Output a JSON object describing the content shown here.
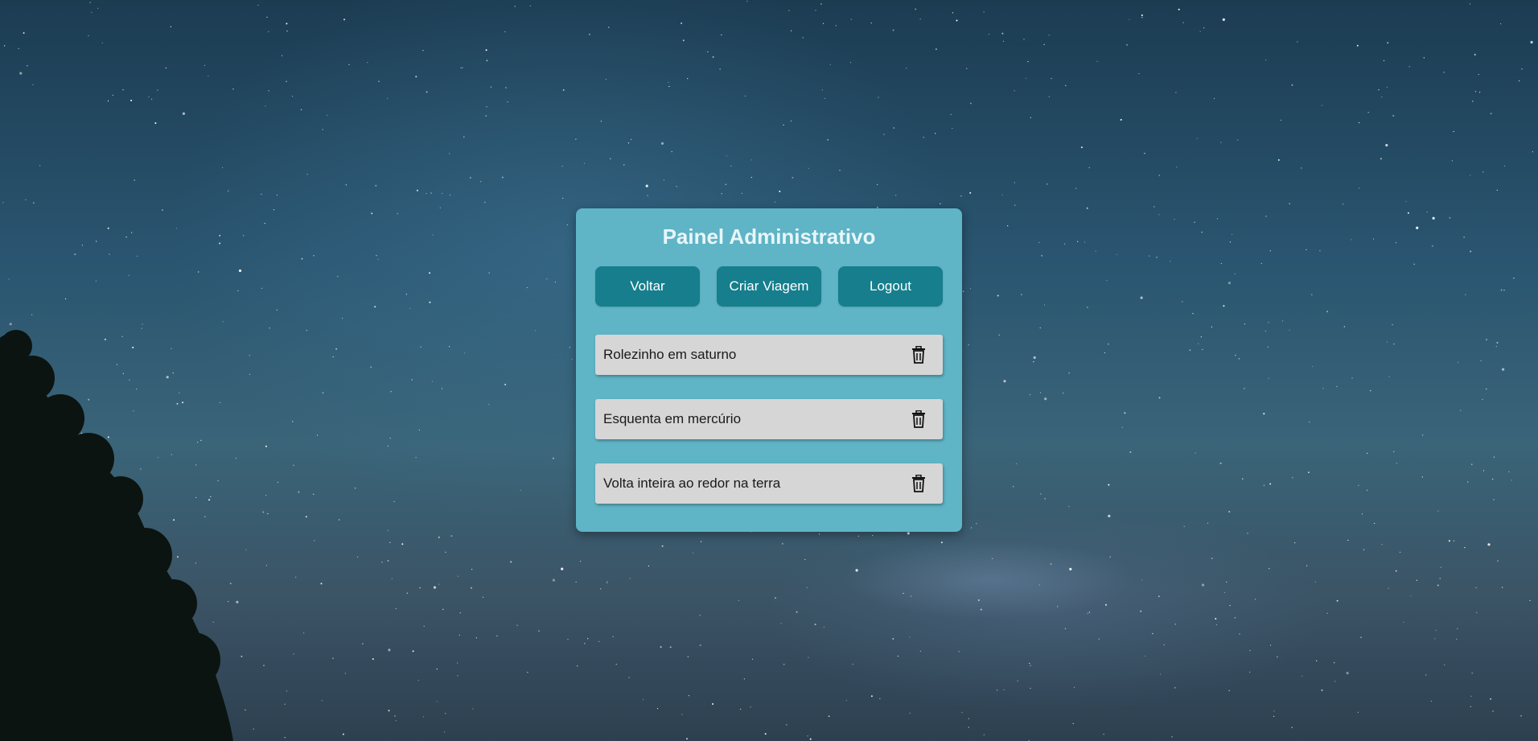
{
  "panel": {
    "title": "Painel Administrativo",
    "buttons": {
      "back": "Voltar",
      "create_trip": "Criar Viagem",
      "logout": "Logout"
    },
    "trips": [
      {
        "name": "Rolezinho em saturno",
        "action_icon": "trash-icon"
      },
      {
        "name": "Esquenta em mercúrio",
        "action_icon": "trash-icon"
      },
      {
        "name": "Volta inteira ao redor na terra",
        "action_icon": "trash-icon"
      }
    ]
  },
  "colors": {
    "panel_bg": "#5fb4c6",
    "button_bg": "#167e8d",
    "trip_bg": "#d6d6d6",
    "title_text": "#e8f6fa"
  }
}
